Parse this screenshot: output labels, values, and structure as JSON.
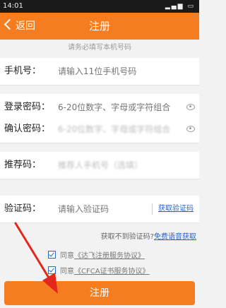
{
  "status_bar": {
    "time": "14:01"
  },
  "nav": {
    "back_label": "返回",
    "title": "注册"
  },
  "hint": "请务必填写本机号码",
  "form": {
    "phone": {
      "label": "手机号：",
      "placeholder": "请输入11位手机号码"
    },
    "password": {
      "label": "登录密码：",
      "placeholder": "6-20位数字、字母或字符组合"
    },
    "confirm_password": {
      "label": "确认密码：",
      "placeholder": "6-20位数字、字母或字符组合"
    },
    "referrer": {
      "label": "推荐码：",
      "placeholder": "推荐人手机号（选填）"
    },
    "captcha": {
      "label": "验证码：",
      "placeholder": "请输入验证码",
      "get_code": "获取验证码"
    }
  },
  "voice": {
    "text": "获取不到验证码?",
    "link": "免费语音获取"
  },
  "agreements": [
    {
      "prefix": "同意",
      "link": "《达飞注册服务协议》",
      "checked": true
    },
    {
      "prefix": "同意",
      "link": "《CFCA证书服务协议》",
      "checked": true
    }
  ],
  "submit_label": "注册",
  "colors": {
    "brand": "#f57d1f",
    "link": "#2a64c4",
    "arrow": "#e5261e"
  }
}
